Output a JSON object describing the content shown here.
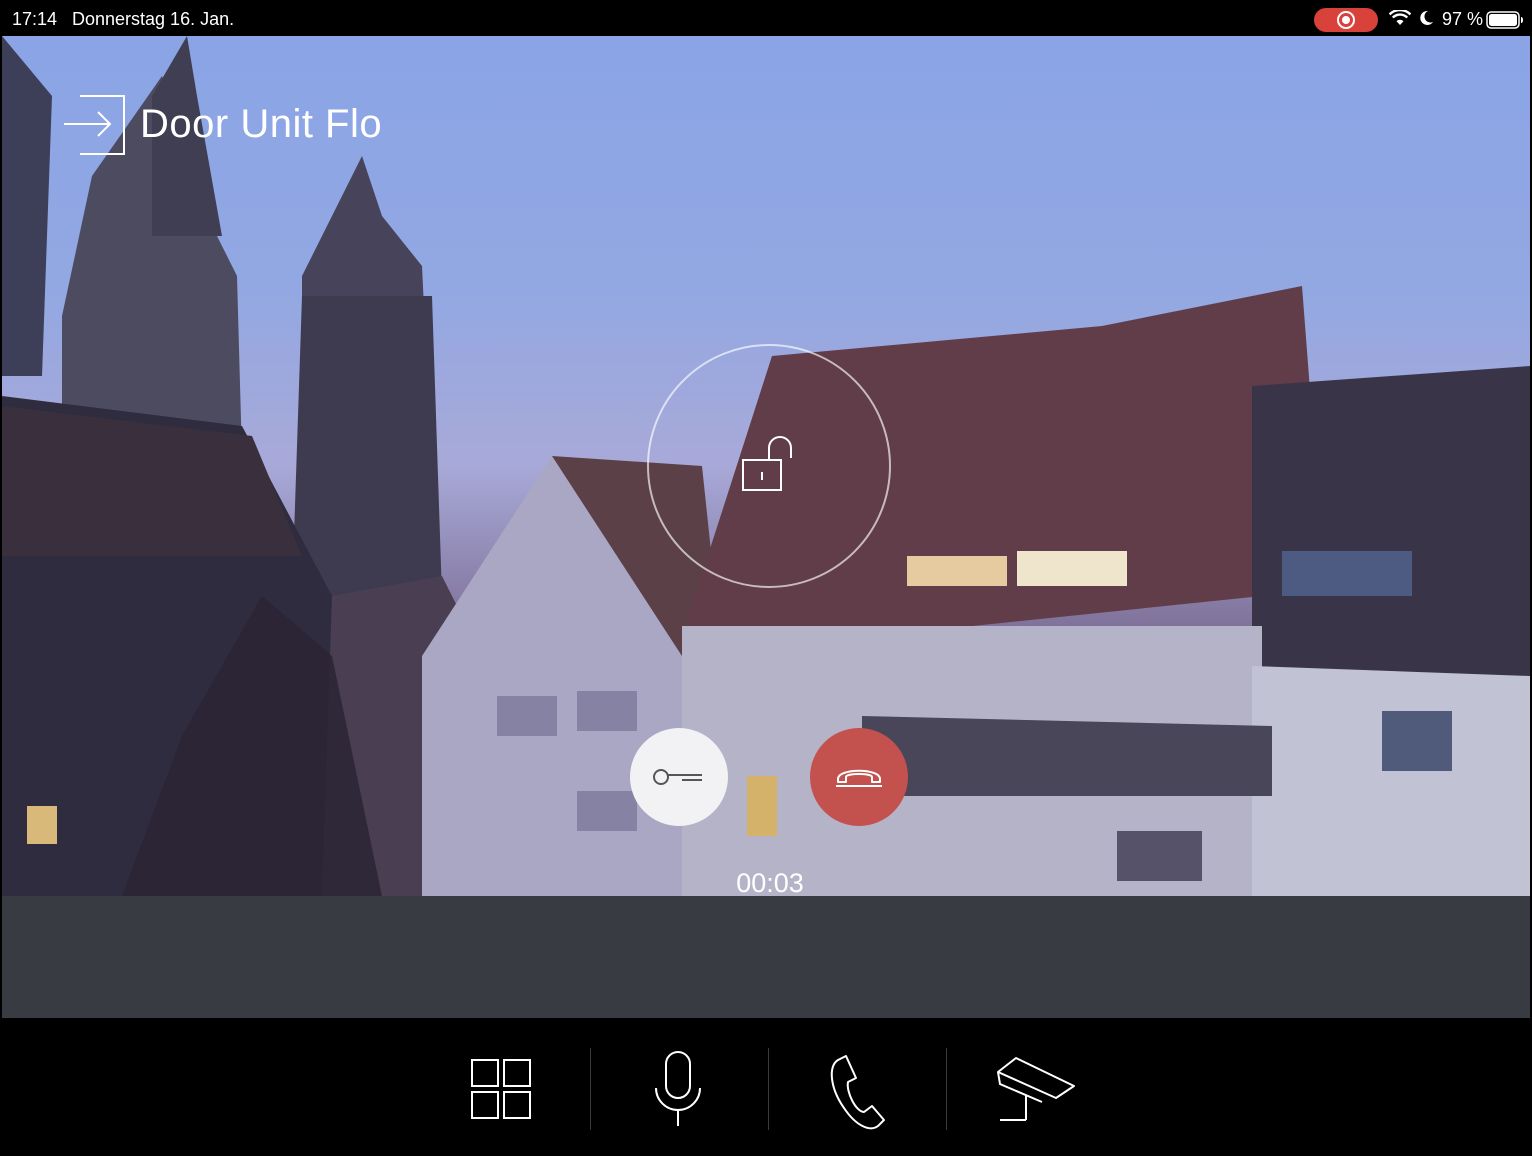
{
  "status_bar": {
    "time": "17:14",
    "date": "Donnerstag 16. Jan.",
    "battery_percent": "97 %",
    "recording_color": "#d9413b"
  },
  "call": {
    "door_title": "Door Unit Flo",
    "timer": "00:03",
    "hangup_color": "#c3514d"
  },
  "icons": {
    "header": "door-enter-icon",
    "unlock": "padlock-open-icon",
    "key": "key-icon",
    "hangup": "phone-hangup-icon"
  },
  "toolbar": {
    "items": [
      {
        "name": "grid-icon"
      },
      {
        "name": "microphone-icon"
      },
      {
        "name": "phone-icon"
      },
      {
        "name": "camera-icon"
      }
    ]
  }
}
